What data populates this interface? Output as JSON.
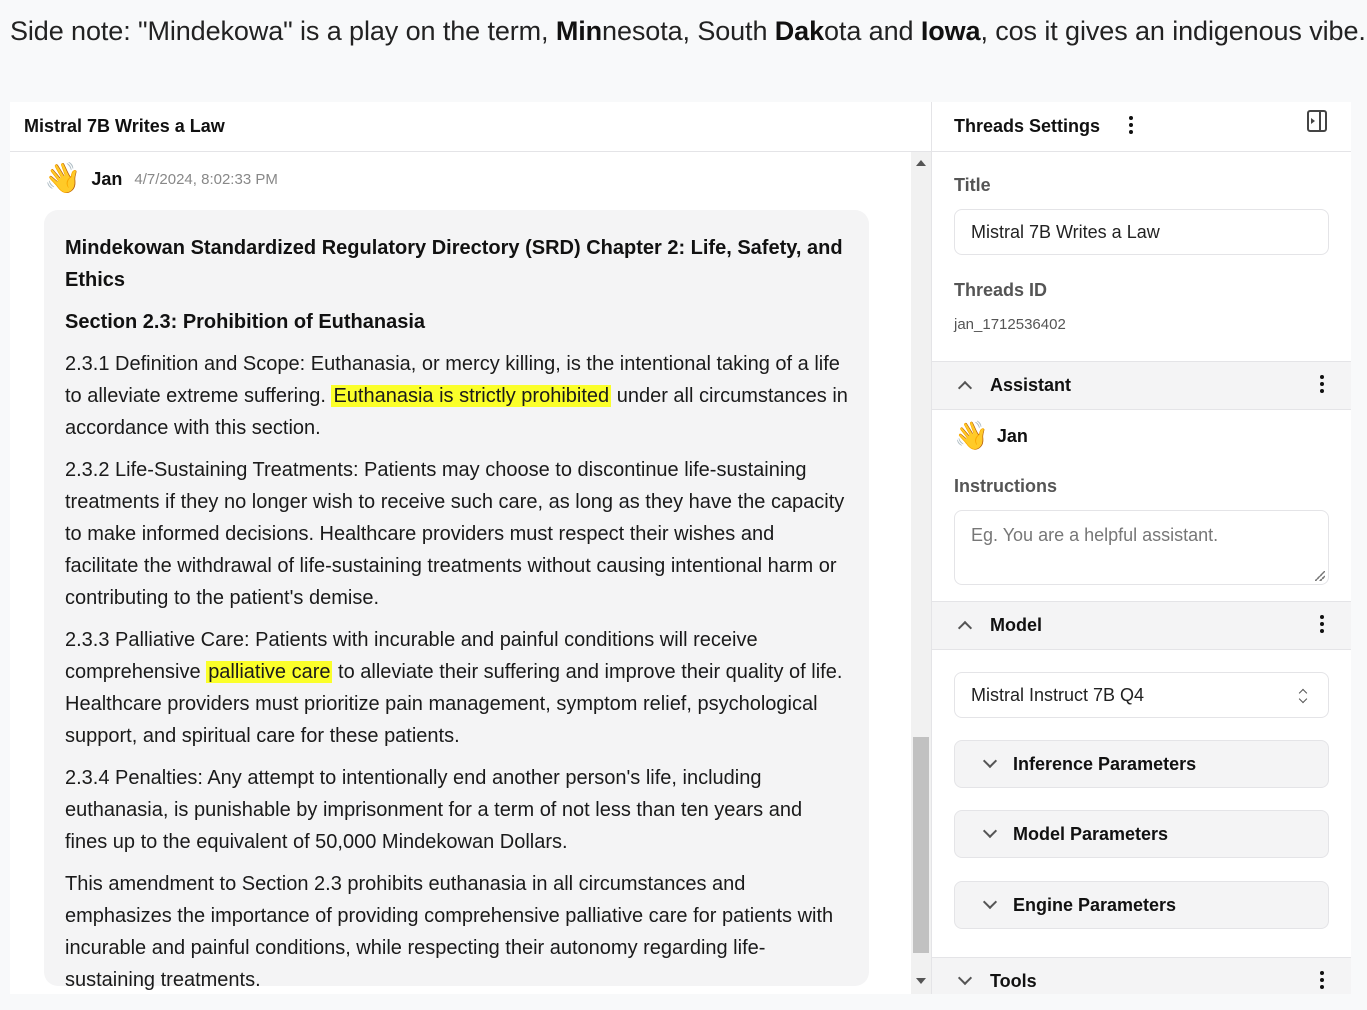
{
  "side_note": {
    "p1": "Side note: \"Mindekowa\" is a play on the term, ",
    "b1": "Min",
    "p2": "nesota, South ",
    "b2": "Dak",
    "p3": "ota and ",
    "b3": "Iowa",
    "p4": ", cos it gives an indigenous vibe."
  },
  "chat": {
    "title": "Mistral 7B Writes a Law",
    "author": "Jan",
    "timestamp": "4/7/2024, 8:02:33 PM",
    "heading": "Mindekowan Standardized Regulatory Directory (SRD) Chapter 2: Life, Safety, and Ethics",
    "section_heading": "Section 2.3: Prohibition of Euthanasia",
    "p1_a": "2.3.1 Definition and Scope: Euthanasia, or mercy killing, is the intentional taking of a life to alleviate extreme suffering. ",
    "p1_hl": "Euthanasia is strictly prohibited",
    "p1_b": " under all circumstances in accordance with this section.",
    "p2": "2.3.2 Life-Sustaining Treatments: Patients may choose to discontinue life-sustaining treatments if they no longer wish to receive such care, as long as they have the capacity to make informed decisions. Healthcare providers must respect their wishes and facilitate the withdrawal of life-sustaining treatments without causing intentional harm or contributing to the patient's demise.",
    "p3_a": "2.3.3 Palliative Care: Patients with incurable and painful conditions will receive comprehensive ",
    "p3_hl": "palliative care",
    "p3_b": " to alleviate their suffering and improve their quality of life. Healthcare providers must prioritize pain management, symptom relief, psychological support, and spiritual care for these patients.",
    "p4": "2.3.4 Penalties: Any attempt to intentionally end another person's life, including euthanasia, is punishable by imprisonment for a term of not less than ten years and fines up to the equivalent of 50,000 Mindekowan Dollars.",
    "p5": "This amendment to Section 2.3 prohibits euthanasia in all circumstances and emphasizes the importance of providing comprehensive palliative care for patients with incurable and painful conditions, while respecting their autonomy regarding life-sustaining treatments."
  },
  "settings": {
    "header": "Threads Settings",
    "title_label": "Title",
    "title_value": "Mistral 7B Writes a Law",
    "id_label": "Threads ID",
    "id_value": "jan_1712536402",
    "assistant_section": "Assistant",
    "assistant_name": "Jan",
    "instructions_label": "Instructions",
    "instructions_placeholder": "Eg. You are a helpful assistant.",
    "model_section": "Model",
    "model_selected": "Mistral Instruct 7B Q4",
    "inference_params": "Inference Parameters",
    "model_params": "Model Parameters",
    "engine_params": "Engine Parameters",
    "tools_section": "Tools"
  },
  "icons": {
    "avatar": "waving-hand",
    "panel": "sidebar-collapse-icon"
  },
  "colors": {
    "highlight": "#fbff2a",
    "bubble": "#f4f4f5",
    "border": "#e4e4e7"
  }
}
